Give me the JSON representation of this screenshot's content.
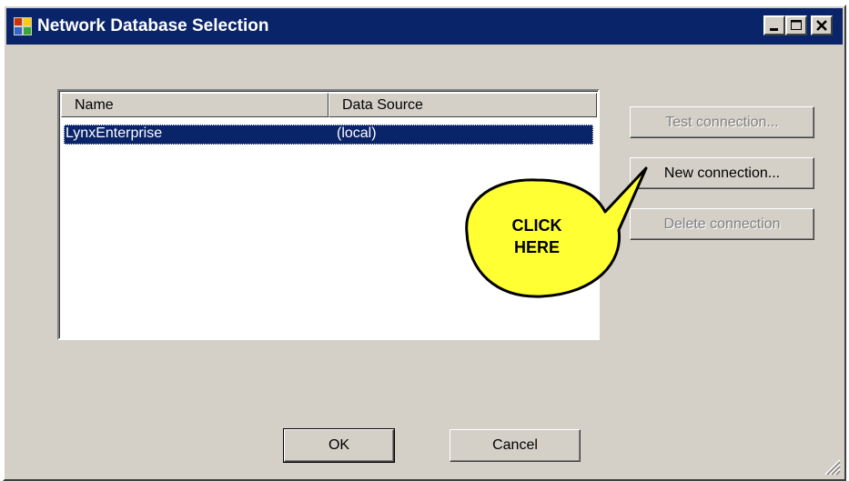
{
  "window": {
    "title": "Network Database Selection"
  },
  "list": {
    "columns": [
      "Name",
      "Data Source"
    ],
    "rows": [
      {
        "name": "LynxEnterprise",
        "data_source": "(local)"
      }
    ]
  },
  "buttons": {
    "test": "Test connection...",
    "new": "New connection...",
    "delete": "Delete connection",
    "ok": "OK",
    "cancel": "Cancel"
  },
  "callout": {
    "line1": "CLICK",
    "line2": "HERE"
  },
  "colors": {
    "titlebar": "#0a246a",
    "selection": "#0a246a",
    "face": "#d4d0c8",
    "callout_fill": "#ffff33"
  }
}
